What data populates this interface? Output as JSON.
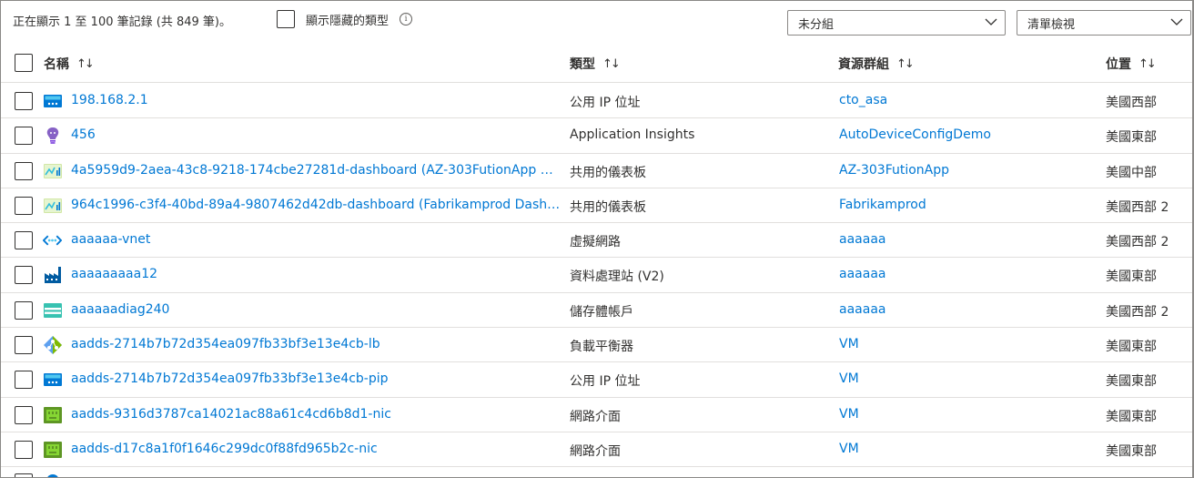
{
  "toolbar": {
    "record_count": "正在顯示 1 至 100 筆記錄 (共 849 筆)。",
    "show_hidden_label": "顯示隱藏的類型",
    "info_icon": "info-icon",
    "group_dropdown": {
      "selected": "未分組"
    },
    "view_dropdown": {
      "selected": "清單檢視"
    }
  },
  "columns": {
    "name": {
      "label": "名稱",
      "sort": "↑↓"
    },
    "type": {
      "label": "類型",
      "sort": "↑↓"
    },
    "resource_group": {
      "label": "資源群組",
      "sort": "↑↓"
    },
    "location": {
      "label": "位置",
      "sort": "↑↓"
    }
  },
  "rows": [
    {
      "name": "198.168.2.1",
      "type": "公用 IP 位址",
      "resource_group": "cto_asa",
      "location": "美國西部",
      "icon": "public-ip-icon"
    },
    {
      "name": "456",
      "type": "Application Insights",
      "resource_group": "AutoDeviceConfigDemo",
      "location": "美國東部",
      "icon": "app-insights-icon"
    },
    {
      "name": "4a5959d9-2aea-43c8-9218-174cbe27281d-dashboard (AZ-303FutionApp Da...",
      "type": "共用的儀表板",
      "resource_group": "AZ-303FutionApp",
      "location": "美國中部",
      "icon": "dashboard-icon"
    },
    {
      "name": "964c1996-c3f4-40bd-89a4-9807462d42db-dashboard (Fabrikamprod Dashb...",
      "type": "共用的儀表板",
      "resource_group": "Fabrikamprod",
      "location": "美國西部 2",
      "icon": "dashboard-icon"
    },
    {
      "name": "aaaaaa-vnet",
      "type": "虛擬網路",
      "resource_group": "aaaaaa",
      "location": "美國西部 2",
      "icon": "vnet-icon"
    },
    {
      "name": "aaaaaaaaa12",
      "type": "資料處理站 (V2)",
      "resource_group": "aaaaaa",
      "location": "美國東部",
      "icon": "data-factory-icon"
    },
    {
      "name": "aaaaaadiag240",
      "type": "儲存體帳戶",
      "resource_group": "aaaaaa",
      "location": "美國西部 2",
      "icon": "storage-account-icon"
    },
    {
      "name": "aadds-2714b7b72d354ea097fb33bf3e13e4cb-lb",
      "type": "負載平衡器",
      "resource_group": "VM",
      "location": "美國東部",
      "icon": "load-balancer-icon"
    },
    {
      "name": "aadds-2714b7b72d354ea097fb33bf3e13e4cb-pip",
      "type": "公用 IP 位址",
      "resource_group": "VM",
      "location": "美國東部",
      "icon": "public-ip-icon"
    },
    {
      "name": "aadds-9316d3787ca14021ac88a61c4cd6b8d1-nic",
      "type": "網路介面",
      "resource_group": "VM",
      "location": "美國東部",
      "icon": "network-interface-icon"
    },
    {
      "name": "aadds-d17c8a1f0f1646c299dc0f88fd965b2c-nic",
      "type": "網路介面",
      "resource_group": "VM",
      "location": "美國東部",
      "icon": "network-interface-icon"
    }
  ],
  "colors": {
    "link": "#0078d4",
    "text": "#323130",
    "border": "#8a8886",
    "divider": "#e1dfdd"
  }
}
